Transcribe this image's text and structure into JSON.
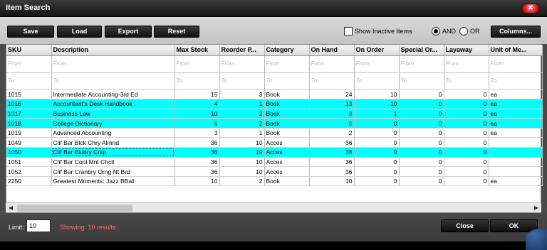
{
  "window": {
    "title": "Item Search",
    "close_glyph": "✕"
  },
  "toolbar": {
    "save": "Save",
    "load": "Load",
    "export": "Export",
    "reset": "Reset",
    "show_inactive": "Show Inactive Items",
    "and": "AND",
    "or": "OR",
    "selected_logic": "AND",
    "columns": "Columns..."
  },
  "filters": {
    "from": "From",
    "to": "To"
  },
  "columns": [
    "SKU",
    "Description",
    "Max Stock",
    "Reorder P...",
    "Category",
    "On Hand",
    "On Order",
    "Special Or...",
    "Layaway",
    "Unit of Me..."
  ],
  "rows": [
    {
      "sku": "1015",
      "desc": "Intermediate Accounting-3rd Ed",
      "max": "15",
      "reorder": "3",
      "cat": "Book",
      "onhand": "24",
      "onorder": "10",
      "special": "0",
      "layaway": "0",
      "unit": "ea",
      "hl": false
    },
    {
      "sku": "1016",
      "desc": "Accountant's Desk Handbook",
      "max": "4",
      "reorder": "1",
      "cat": "Book",
      "onhand": "13",
      "onorder": "10",
      "special": "0",
      "layaway": "0",
      "unit": "ea",
      "hl": true
    },
    {
      "sku": "1017",
      "desc": "Business Law",
      "max": "10",
      "reorder": "2",
      "cat": "Book",
      "onhand": "9",
      "onorder": "1",
      "special": "0",
      "layaway": "0",
      "unit": "ea",
      "hl": true
    },
    {
      "sku": "1018",
      "desc": "College Dictionary",
      "max": "5",
      "reorder": "2",
      "cat": "Book",
      "onhand": "5",
      "onorder": "0",
      "special": "0",
      "layaway": "0",
      "unit": "ea",
      "hl": true
    },
    {
      "sku": "1019",
      "desc": "Advanced Accounting",
      "max": "3",
      "reorder": "1",
      "cat": "Book",
      "onhand": "2",
      "onorder": "0",
      "special": "0",
      "layaway": "0",
      "unit": "ea",
      "hl": false
    },
    {
      "sku": "1049",
      "desc": "Clif Bar Blck Chry Almnd",
      "max": "36",
      "reorder": "10",
      "cat": "Acces",
      "onhand": "36",
      "onorder": "0",
      "special": "0",
      "layaway": "0",
      "unit": "",
      "hl": false
    },
    {
      "sku": "1050",
      "desc": "Clif Bar Blubry Crsp",
      "max": "36",
      "reorder": "10",
      "cat": "Acces",
      "onhand": "36",
      "onorder": "0",
      "special": "0",
      "layaway": "0",
      "unit": "",
      "hl": true
    },
    {
      "sku": "1051",
      "desc": "Clif Bar Cool Mnt Chclt",
      "max": "36",
      "reorder": "10",
      "cat": "Acces",
      "onhand": "36",
      "onorder": "0",
      "special": "0",
      "layaway": "0",
      "unit": "",
      "hl": false
    },
    {
      "sku": "1052",
      "desc": "Clif Bar Cranbry Orng Nt Brd",
      "max": "36",
      "reorder": "10",
      "cat": "Acces",
      "onhand": "36",
      "onorder": "0",
      "special": "0",
      "layaway": "0",
      "unit": "",
      "hl": false
    },
    {
      "sku": "2250",
      "desc": "Greatest Moments: Jazz BBall",
      "max": "10",
      "reorder": "2",
      "cat": "Book",
      "onhand": "10",
      "onorder": "0",
      "special": "0",
      "layaway": "0",
      "unit": "ea",
      "hl": false
    }
  ],
  "footer": {
    "limit_label": "Limit:",
    "limit_value": "10",
    "showing": "Showing: 10 results",
    "close": "Close",
    "ok": "OK"
  },
  "scroll": {
    "left_arrow": "◀",
    "right_arrow": "▶"
  },
  "colors": {
    "highlight": "#00ffff",
    "showing_text": "#ff6b6b",
    "close_button": "#c31010"
  }
}
